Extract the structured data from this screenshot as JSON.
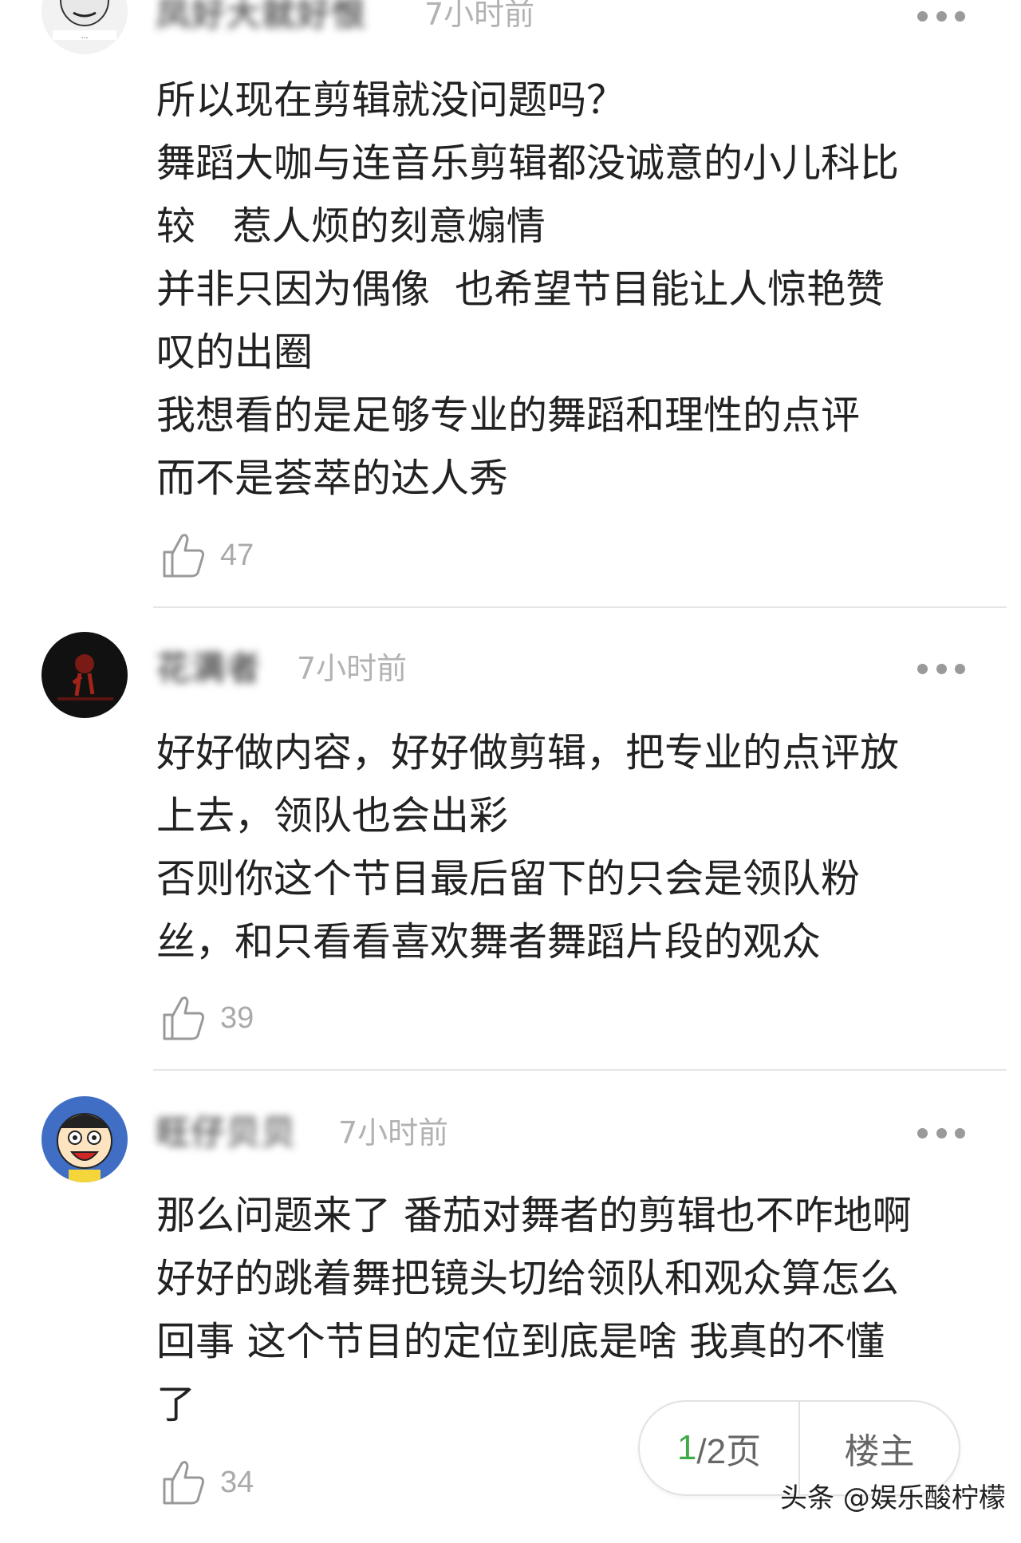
{
  "comments": [
    {
      "username": "凤好大就好恨",
      "time": "7小时前",
      "lines": [
        "所以现在剪辑就没问题吗？",
        "舞蹈大咖与连音乐剪辑都没诚意的小儿科比",
        "较   惹人烦的刻意煽情",
        "并非只因为偶像  也希望节目能让人惊艳赞",
        "叹的出圈",
        "我想看的是足够专业的舞蹈和理性的点评",
        "而不是荟萃的达人秀"
      ],
      "likes": "47",
      "avatar_icon": "meme-face-avatar"
    },
    {
      "username": "花满者",
      "time": "7小时前",
      "lines": [
        "好好做内容，好好做剪辑，把专业的点评放",
        "上去，领队也会出彩",
        "否则你这个节目最后留下的只会是领队粉",
        "丝，和只看看喜欢舞者舞蹈片段的观众"
      ],
      "likes": "39",
      "avatar_icon": "dark-stage-avatar"
    },
    {
      "username": "旺仔贝贝",
      "time": "7小时前",
      "lines": [
        "那么问题来了 番茄对舞者的剪辑也不咋地啊",
        "好好的跳着舞把镜头切给领队和观众算怎么",
        "回事 这个节目的定位到底是啥 我真的不懂",
        "了"
      ],
      "likes": "34",
      "avatar_icon": "cartoon-boy-avatar"
    }
  ],
  "pager": {
    "current": "1",
    "total_suffix": "/2页",
    "owner_label": "楼主"
  },
  "watermark": "头条 @娱乐酸柠檬",
  "colors": {
    "accent": "#3eaa4a",
    "muted": "#b2b2b2",
    "divider": "#e6e6e6"
  },
  "icons": {
    "like": "thumbs-up-icon",
    "more": "more-dots-icon"
  }
}
